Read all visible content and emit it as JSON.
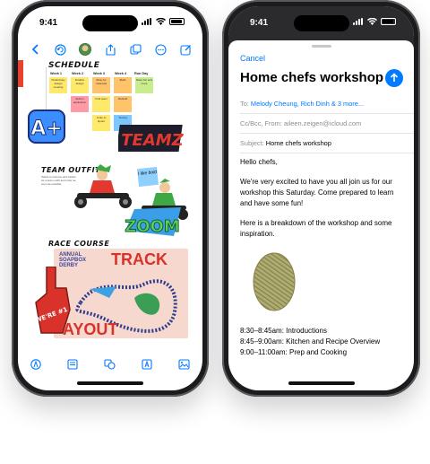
{
  "left_phone": {
    "status": {
      "time": "9:41"
    },
    "canvas": {
      "schedule_title": "SCHEDULE",
      "weeks": [
        "Week 1",
        "Week 2",
        "Week 3",
        "Week 4",
        "Run Day"
      ],
      "stickies": [
        "Preliminary design meeting",
        "Finalize design",
        "Shop for materials",
        "Build",
        "Race fun and more",
        "Submit application",
        "Find team",
        "Rebuild",
        "Invite to layout",
        "Testing",
        "Build",
        "Rebuild"
      ],
      "team_outfit_title": "TEAM OUTFIT",
      "outfit_note": "Select a costume and pattern for a team outfit and order as soon as possible.",
      "like_text": "I like bold",
      "team_sticker": "TEAMZ",
      "zoom_sticker": "ZOOM",
      "race_course_title": "RACE COURSE",
      "race_title": "ANNUAL SOAPBOX DERBY",
      "track_word": "TRACK",
      "layout_word": "AYOUT",
      "foam_finger_text": "WE'RE #1",
      "a_sticker": "A+"
    }
  },
  "right_phone": {
    "status": {
      "time": "9:41"
    },
    "cancel_label": "Cancel",
    "subject_heading": "Home chefs workshop",
    "to_label": "To:",
    "to_value": "Melody Cheung, Rich Dinh & 3 more...",
    "cc_label": "Cc/Bcc, From:",
    "cc_value": "aileen.zeigen@icloud.com",
    "subject_label": "Subject:",
    "subject_value": "Home chefs workshop",
    "body": {
      "greeting": "Hello chefs,",
      "para1": "We're very excited to have you all join us for our workshop this Saturday. Come prepared to learn and have some fun!",
      "para2": "Here is a breakdown of the workshop and some inspiration.",
      "schedule": [
        "8:30–8:45am: Introductions",
        "8:45–9:00am: Kitchen and Recipe Overview",
        "9:00–11:00am: Prep and Cooking"
      ]
    }
  },
  "colors": {
    "accent": "#007aff",
    "team_red": "#d8322a"
  }
}
